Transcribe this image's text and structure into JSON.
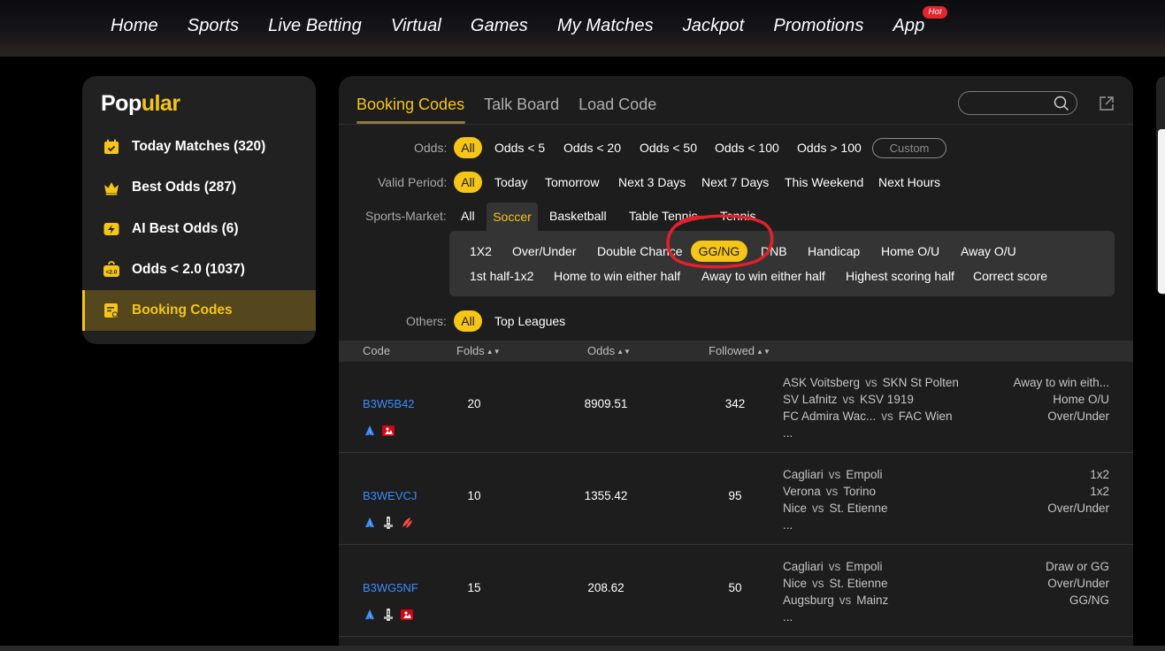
{
  "nav": {
    "items": [
      "Home",
      "Sports",
      "Live Betting",
      "Virtual",
      "Games",
      "My Matches",
      "Jackpot",
      "Promotions",
      "App"
    ],
    "badge": "Hot"
  },
  "sidebar": {
    "title_part1": "Pop",
    "title_part2": "ular",
    "items": [
      {
        "label": "Today Matches (320)",
        "icon": "calendar-icon"
      },
      {
        "label": "Best Odds (287)",
        "icon": "crown-icon"
      },
      {
        "label": "AI Best Odds (6)",
        "icon": "lightning-ticket-icon"
      },
      {
        "label": "Odds < 2.0 (1037)",
        "icon": "odds-tag-icon"
      },
      {
        "label": "Booking Codes",
        "icon": "booking-code-icon"
      }
    ],
    "active_index": 4
  },
  "tabs": [
    "Booking Codes",
    "Talk Board",
    "Load Code"
  ],
  "search": {
    "placeholder": ""
  },
  "filters": {
    "odds": {
      "label": "Odds:",
      "options": [
        "All",
        "Odds < 5",
        "Odds < 20",
        "Odds < 50",
        "Odds < 100",
        "Odds > 100"
      ],
      "custom": "Custom"
    },
    "valid_period": {
      "label": "Valid Period:",
      "options": [
        "All",
        "Today",
        "Tomorrow",
        "Next 3 Days",
        "Next 7 Days",
        "This Weekend",
        "Next Hours"
      ]
    },
    "sports_market": {
      "label": "Sports-Market:",
      "options": [
        "All",
        "Soccer",
        "Basketball",
        "Table Tennis",
        "Tennis"
      ]
    },
    "markets_row1": [
      "1X2",
      "Over/Under",
      "Double Chance",
      "GG/NG",
      "DNB",
      "Handicap",
      "Home O/U",
      "Away O/U"
    ],
    "markets_row2": [
      "1st half-1x2",
      "Home to win either half",
      "Away to win either half",
      "Highest scoring half",
      "Correct score"
    ],
    "others": {
      "label": "Others:",
      "options": [
        "All",
        "Top Leagues"
      ]
    }
  },
  "table": {
    "headers": [
      "Code",
      "Folds",
      "Odds",
      "Followed"
    ],
    "rows": [
      {
        "code": "B3W5B42",
        "folds": "20",
        "odds": "8909.51",
        "followed": "342",
        "matches": [
          [
            "ASK Voitsberg",
            "SKN St Polten"
          ],
          [
            "SV Lafnitz",
            "KSV 1919"
          ],
          [
            "FC Admira Wac...",
            "FAC Wien"
          ]
        ],
        "markets": [
          "Away to win eith...",
          "Home O/U",
          "Over/Under"
        ],
        "more": "...",
        "leagues": [
          "league-a-icon",
          "bundesliga-icon"
        ]
      },
      {
        "code": "B3WEVCJ",
        "folds": "10",
        "odds": "1355.42",
        "followed": "95",
        "matches": [
          [
            "Cagliari",
            "Empoli"
          ],
          [
            "Verona",
            "Torino"
          ],
          [
            "Nice",
            "St. Etienne"
          ]
        ],
        "markets": [
          "1x2",
          "1x2",
          "Over/Under"
        ],
        "more": "...",
        "leagues": [
          "league-a-icon",
          "ligue1-icon",
          "laliga-icon"
        ]
      },
      {
        "code": "B3WG5NF",
        "folds": "15",
        "odds": "208.62",
        "followed": "50",
        "matches": [
          [
            "Cagliari",
            "Empoli"
          ],
          [
            "Nice",
            "St. Etienne"
          ],
          [
            "Augsburg",
            "Mainz"
          ]
        ],
        "markets": [
          "Draw or GG",
          "Over/Under",
          "GG/NG"
        ],
        "more": "...",
        "leagues": [
          "league-a-icon",
          "ligue1-icon",
          "bundesliga-icon"
        ]
      }
    ],
    "vs": "vs"
  },
  "colors": {
    "accent": "#f5c518",
    "link": "#3d8bff",
    "annotation": "#e0222a"
  }
}
